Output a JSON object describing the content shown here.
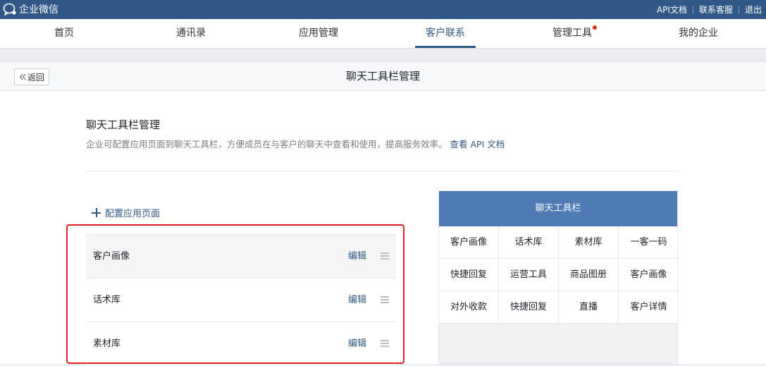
{
  "topbar": {
    "brand": "企业微信",
    "links": [
      "API文档",
      "联系客服",
      "退出"
    ]
  },
  "nav": {
    "items": [
      "首页",
      "通讯录",
      "应用管理",
      "客户联系",
      "管理工具",
      "我的企业"
    ],
    "active": "客户联系",
    "notification_on": "管理工具"
  },
  "page": {
    "back_label": "返回",
    "title": "聊天工具栏管理"
  },
  "section": {
    "title": "聊天工具栏管理",
    "description": "企业可配置应用页面到聊天工具栏，方便成员在与客户的聊天中查看和使用，提高服务效率。",
    "api_link": "查看 API 文档"
  },
  "config": {
    "add_label": "配置应用页面"
  },
  "list": [
    {
      "label": "客户画像",
      "action": "编辑"
    },
    {
      "label": "话术库",
      "action": "编辑"
    },
    {
      "label": "素材库",
      "action": "编辑"
    }
  ],
  "preview": {
    "title": "聊天工具栏",
    "items": [
      "客户画像",
      "话术库",
      "素材库",
      "一客一码",
      "快捷回复",
      "运营工具",
      "商品图册",
      "客户画像",
      "对外收款",
      "快捷回复",
      "直播",
      "客户详情"
    ]
  },
  "colors": {
    "topbar": "#2f5887",
    "accent": "#2f5887",
    "preview_header": "#4e7ab5",
    "highlight": "#e02020",
    "notification": "#e6270d"
  }
}
